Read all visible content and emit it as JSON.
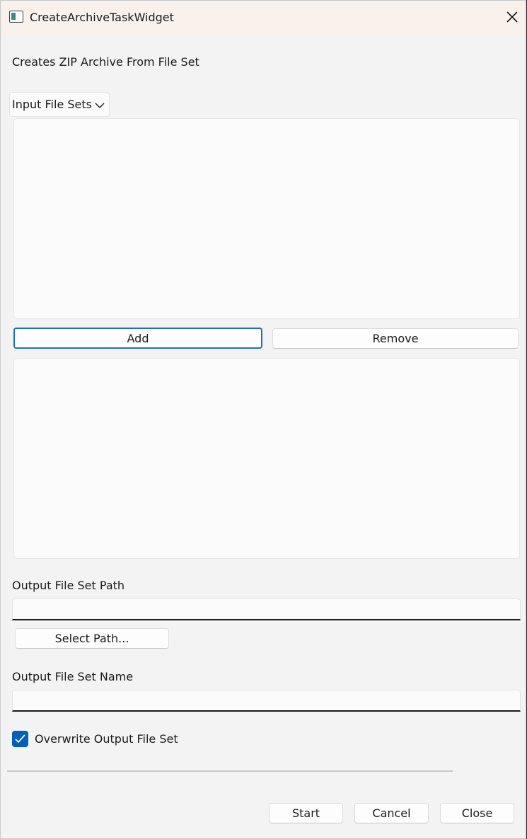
{
  "window": {
    "title": "CreateArchiveTaskWidget",
    "icon": "app-window-icon",
    "close_icon": "close-icon"
  },
  "description": "Creates ZIP Archive From File Set",
  "input_file_sets": {
    "combo_label": "Input File Sets",
    "combo_icon": "chevron-down-icon",
    "add_label": "Add",
    "remove_label": "Remove"
  },
  "output_path": {
    "label": "Output File Set Path",
    "value": "",
    "select_label": "Select Path..."
  },
  "output_name": {
    "label": "Output File Set Name",
    "value": ""
  },
  "overwrite": {
    "label": "Overwrite Output File Set",
    "checked": true
  },
  "progress": {
    "value": 0
  },
  "footer": {
    "start_label": "Start",
    "cancel_label": "Cancel",
    "close_label": "Close"
  },
  "colors": {
    "accent": "#005fb8",
    "focus_border": "#1f6fbf",
    "titlebar": "#f8f1ec",
    "background": "#f3f3f3"
  }
}
